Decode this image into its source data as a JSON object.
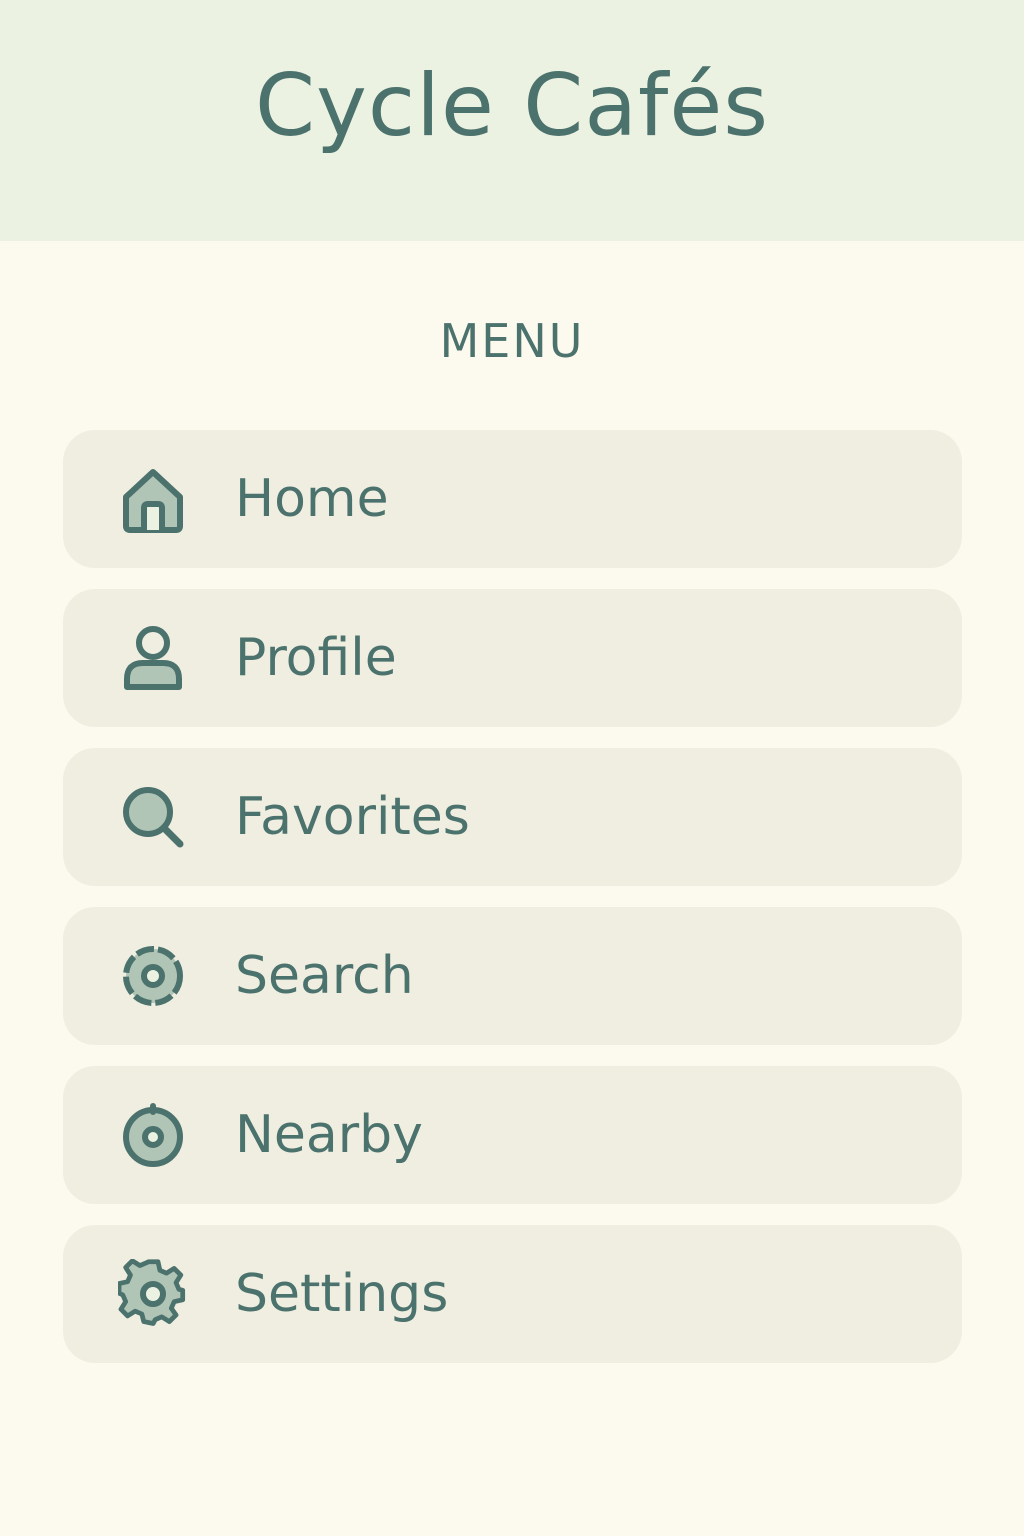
{
  "app": {
    "title": "Cycle Cafés"
  },
  "menu": {
    "heading": "MENU",
    "items": [
      {
        "label": "Home",
        "icon": "home-icon"
      },
      {
        "label": "Profile",
        "icon": "user-icon"
      },
      {
        "label": "Favorites",
        "icon": "search-icon"
      },
      {
        "label": "Search",
        "icon": "gear-outline-icon"
      },
      {
        "label": "Nearby",
        "icon": "location-pin-icon"
      },
      {
        "label": "Settings",
        "icon": "gear-icon"
      }
    ]
  },
  "colors": {
    "header_bg": "#ecf2e2",
    "page_bg": "#fcf9ee",
    "item_bg": "#efeee0",
    "text": "#4b726d",
    "icon_fill": "#b1c5b6"
  }
}
